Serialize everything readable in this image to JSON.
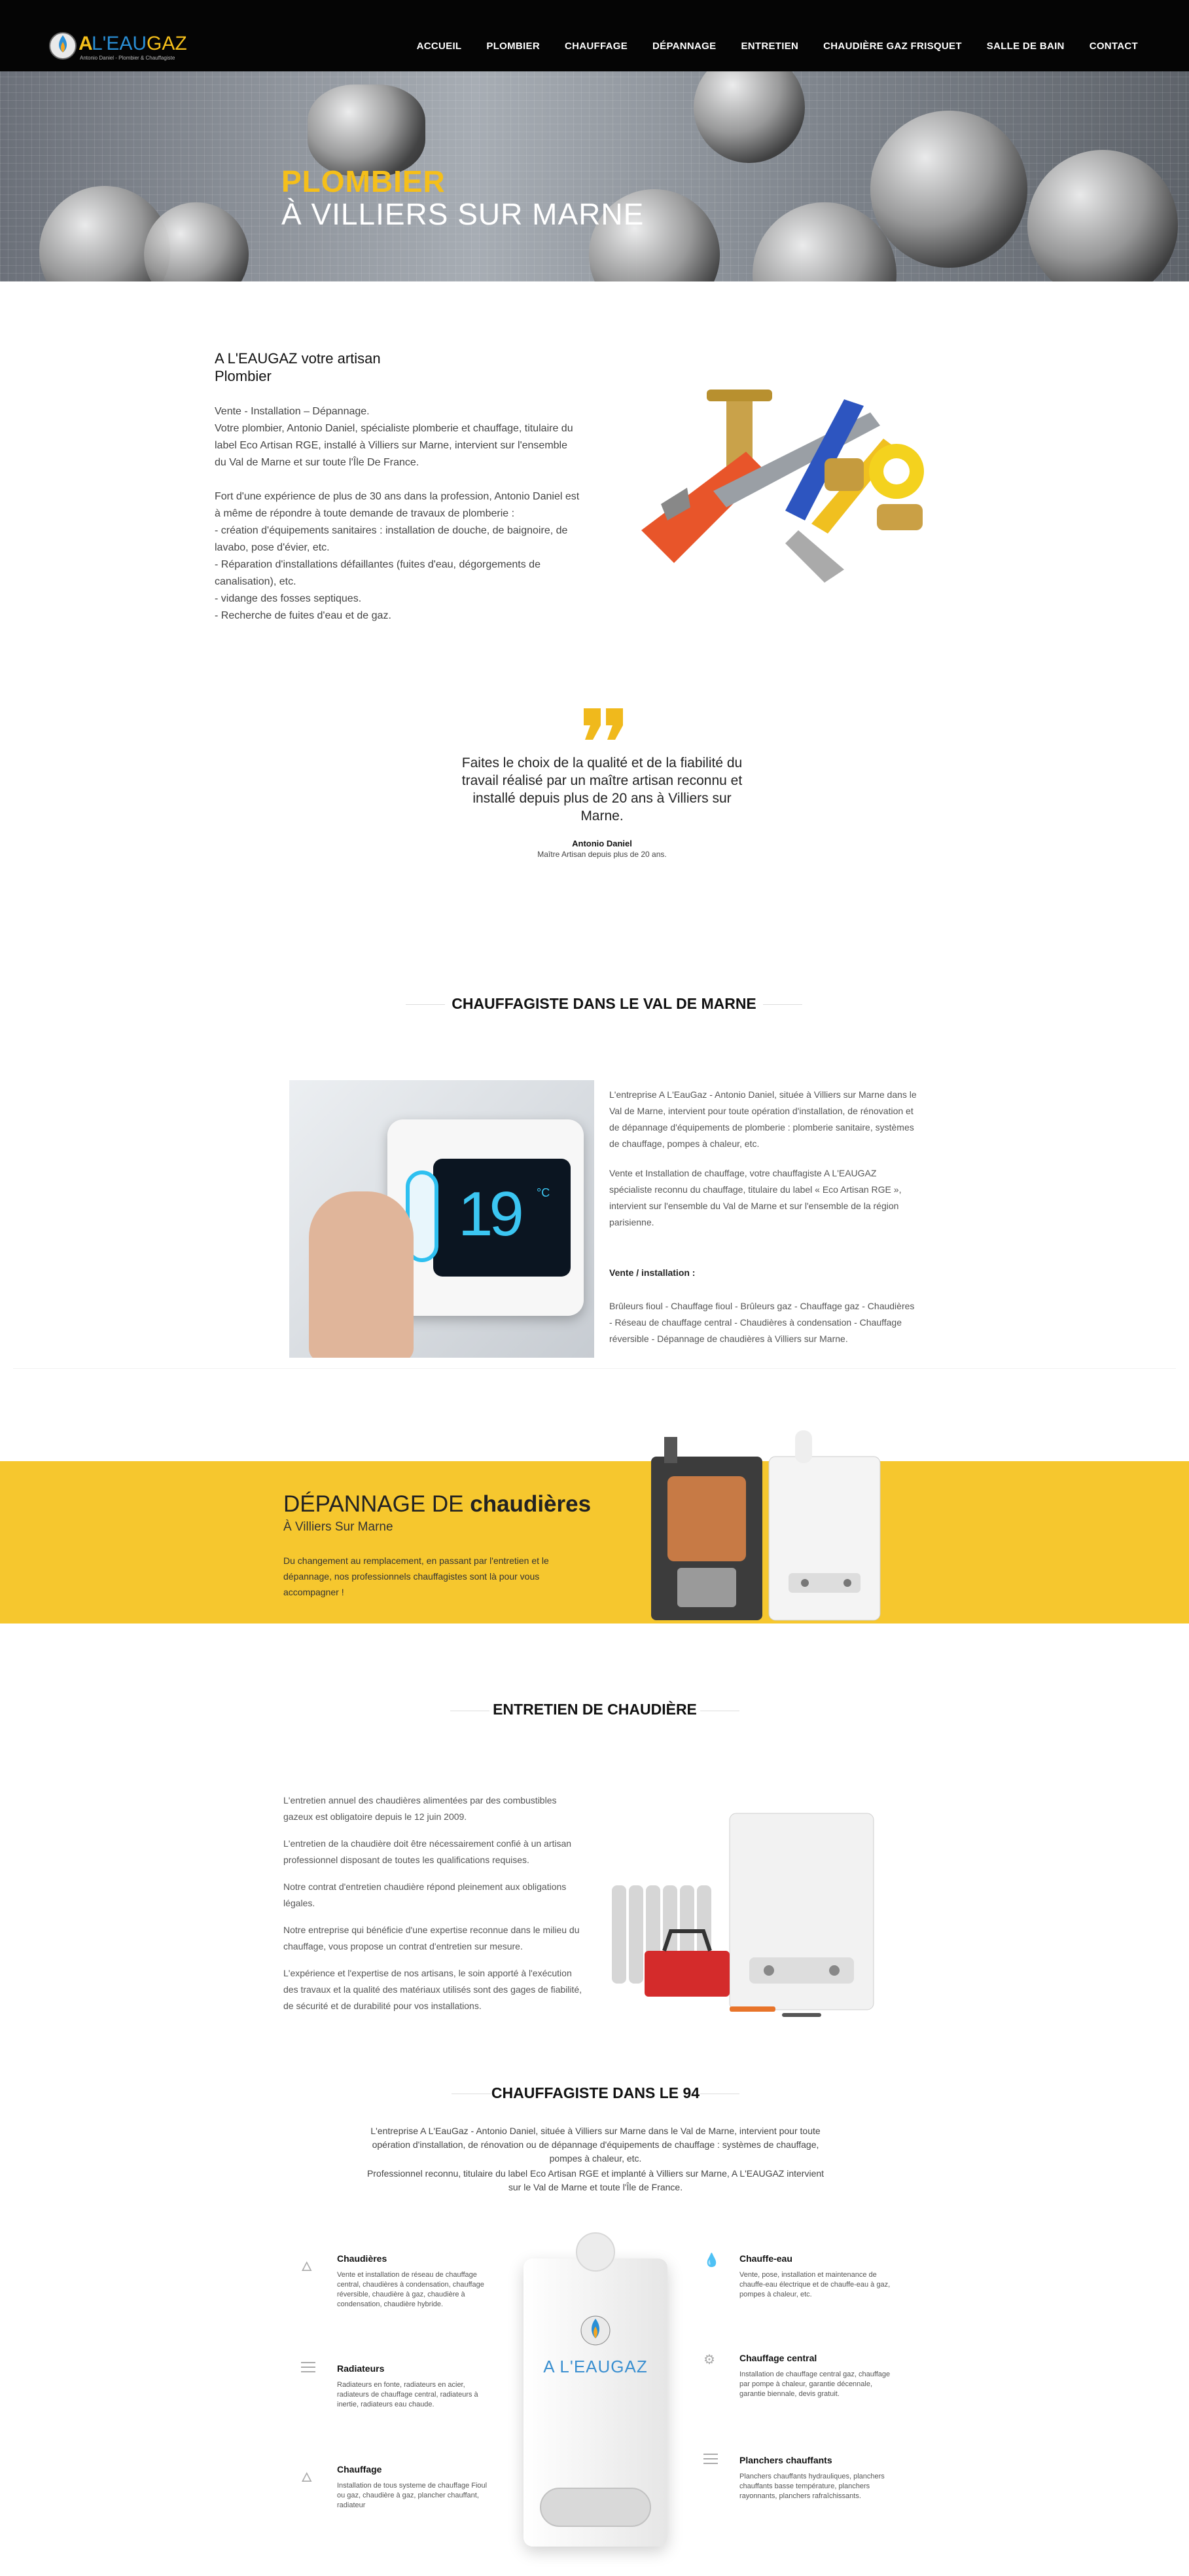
{
  "brand": {
    "logo_text": "A L'EAUGAZ",
    "logo_tagline": "Antonio Daniel - Plombier & Chauffagiste"
  },
  "nav": {
    "items": [
      "ACCUEIL",
      "PLOMBIER",
      "CHAUFFAGE",
      "DÉPANNAGE",
      "ENTRETIEN",
      "CHAUDIÈRE GAZ FRISQUET",
      "SALLE DE BAIN",
      "CONTACT"
    ]
  },
  "hero": {
    "title_line1": "PLOMBIER",
    "title_line2": "À VILLIERS SUR MARNE"
  },
  "intro": {
    "title": "A L'EAUGAZ votre artisan Plombier",
    "paragraphs": [
      "Vente - Installation – Dépannage.",
      "Votre plombier, Antonio Daniel, spécialiste plomberie et chauffage, titulaire du label Eco Artisan RGE, installé à Villiers sur Marne, intervient sur l'ensemble du Val de Marne et sur toute l'Île De France.",
      "",
      "Fort d'une expérience de plus de 30 ans dans la profession, Antonio Daniel est à même de répondre à toute demande de travaux de plomberie :",
      "- création d'équipements sanitaires : installation de douche, de baignoire, de lavabo, pose d'évier, etc.",
      "- Réparation d'installations défaillantes (fuites d'eau, dégorgements de canalisation), etc.",
      "- vidange des fosses septiques.",
      "- Recherche de fuites d'eau et de gaz."
    ]
  },
  "quote": {
    "text": "Faites le choix de la qualité et de la fiabilité du travail réalisé par un maître artisan reconnu et installé depuis plus de 20 ans à Villiers sur Marne.",
    "author": "Antonio Daniel",
    "role": "Maître Artisan depuis plus de 20 ans."
  },
  "chauffagiste": {
    "title": "CHAUFFAGISTE DANS LE VAL DE MARNE",
    "thermostat_display": "19",
    "thermostat_unit": "°C",
    "paragraphs": [
      "L'entreprise A L'EauGaz - Antonio Daniel, située à Villiers sur Marne dans le Val de Marne, intervient pour toute opération d'installation, de rénovation et de dépannage d'équipements de plomberie : plomberie sanitaire, systèmes de chauffage, pompes à chaleur, etc.",
      "Vente et Installation de chauffage, votre chauffagiste A L'EAUGAZ spécialiste reconnu du chauffage, titulaire du label « Eco Artisan RGE », intervient sur l'ensemble du Val de Marne et sur l'ensemble de la région parisienne."
    ],
    "sales_label": "Vente / installation :",
    "sales_text": "Brûleurs fioul - Chauffage fioul - Brûleurs gaz - Chauffage gaz - Chaudières - Réseau de chauffage central - Chaudières à condensation - Chauffage réversible - Dépannage de chaudières à Villiers sur Marne."
  },
  "depannage": {
    "title_light": "DÉPANNAGE DE ",
    "title_bold": "chaudières",
    "subtitle": "À Villiers Sur Marne",
    "text": "Du changement au remplacement, en passant par l'entretien et le dépannage, nos professionnels chauffagistes sont là pour vous accompagner !"
  },
  "entretien": {
    "title": "ENTRETIEN DE CHAUDIÈRE",
    "paragraphs": [
      "L'entretien annuel des chaudières alimentées par des combustibles gazeux est obligatoire depuis le 12 juin 2009.",
      "L'entretien de la chaudière doit être nécessairement confié à un artisan professionnel disposant de toutes les qualifications requises.",
      "Notre contrat d'entretien chaudière répond pleinement aux obligations légales.",
      "Notre entreprise qui bénéficie d'une expertise reconnue dans le milieu du chauffage, vous propose un contrat d'entretien sur mesure.",
      "L'expérience et l'expertise de nos artisans, le soin apporté à l'exécution des travaux et la qualité des matériaux utilisés sont des gages de fiabilité, de sécurité et de durabilité pour vos installations."
    ]
  },
  "chauffagiste94": {
    "title": "CHAUFFAGISTE DANS LE 94",
    "paragraphs": [
      "L'entreprise A L'EauGaz - Antonio Daniel, située à Villiers sur Marne dans le Val de Marne, intervient pour toute opération d'installation, de rénovation ou de dépannage d'équipements de chauffage : systèmes de chauffage, pompes à chaleur, etc.",
      "Professionnel reconnu, titulaire du label Eco Artisan RGE et implanté à Villiers sur Marne, A L'EAUGAZ intervient sur le Val de Marne et toute l'Île de France."
    ],
    "boiler_logo": "A L'EAUGAZ",
    "features_left": [
      {
        "title": "Chaudières",
        "icon": "flame-icon",
        "desc": "Vente et installation de réseau de chauffage central, chaudières à condensation, chauffage réversible, chaudière à gaz, chaudière à condensation, chaudière hybride."
      },
      {
        "title": "Radiateurs",
        "icon": "bars-icon",
        "desc": "Radiateurs en fonte, radiateurs en acier, radiateurs de chauffage central, radiateurs à inertie, radiateurs eau chaude."
      },
      {
        "title": "Chauffage",
        "icon": "flame-icon",
        "desc": "Installation de tous systeme de chauffage Fioul ou gaz, chaudière à gaz, plancher chauffant, radiateur"
      }
    ],
    "features_right": [
      {
        "title": "Chauffe-eau",
        "icon": "drop-icon",
        "desc": "Vente, pose, installation et maintenance de chauffe-eau électrique et de chauffe-eau à gaz, pompes à chaleur, etc."
      },
      {
        "title": "Chauffage central",
        "icon": "gears-icon",
        "desc": "Installation de chauffage central gaz, chauffage par pompe à chaleur, garantie décennale, garantie biennale, devis gratuit."
      },
      {
        "title": "Planchers chauffants",
        "icon": "bars-icon",
        "desc": "Planchers chauffants hydrauliques, planchers chauffants basse température, planchers rayonnants, planchers rafraîchissants."
      }
    ]
  },
  "colors": {
    "accent": "#f5bf1a",
    "header_bg": "#050505",
    "band_bg": "#f6c72e"
  }
}
